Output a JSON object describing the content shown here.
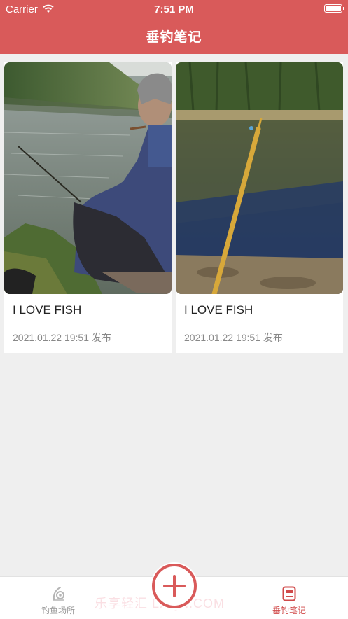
{
  "status_bar": {
    "carrier": "Carrier",
    "time": "7:51 PM"
  },
  "header": {
    "title": "垂钓笔记"
  },
  "notes": [
    {
      "title": "I LOVE FISH",
      "date": "2021.01.22 19:51 发布",
      "photo": "old-man-fishing-by-river"
    },
    {
      "title": "I LOVE FISH",
      "date": "2021.01.22 19:51 发布",
      "photo": "fishing-rod-over-pond"
    }
  ],
  "tabbar": {
    "tabs": [
      {
        "label": "钓鱼场所",
        "icon": "fishing-spot-icon",
        "active": false
      },
      {
        "label": "垂钓笔记",
        "icon": "notebook-icon",
        "active": true
      }
    ],
    "fab_icon": "add-icon"
  },
  "watermark": "乐享轻汇 LXQH.COM",
  "colors": {
    "accent": "#d95a5a",
    "active_tab": "#d04a4a",
    "inactive_tab": "#999999"
  }
}
